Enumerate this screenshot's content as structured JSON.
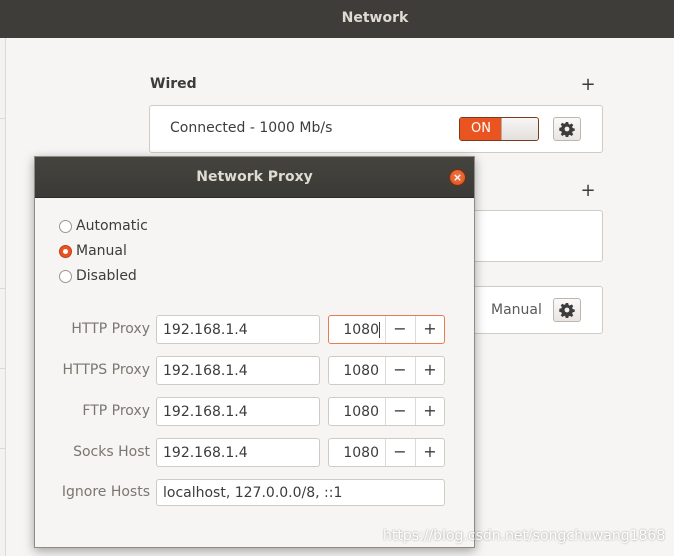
{
  "window": {
    "title": "Network"
  },
  "wired": {
    "section_title": "Wired",
    "add_symbol": "+",
    "status": "Connected - 1000 Mb/s",
    "switch_label": "ON"
  },
  "second_section": {
    "add_symbol": "+"
  },
  "proxy_row": {
    "mode_label": "Manual"
  },
  "dialog": {
    "title": "Network Proxy",
    "close_symbol": "×",
    "modes": [
      {
        "label": "Automatic",
        "checked": false
      },
      {
        "label": "Manual",
        "checked": true
      },
      {
        "label": "Disabled",
        "checked": false
      }
    ],
    "http": {
      "label": "HTTP Proxy",
      "host": "192.168.1.4",
      "port": "1080"
    },
    "https": {
      "label": "HTTPS Proxy",
      "host": "192.168.1.4",
      "port": "1080"
    },
    "ftp": {
      "label": "FTP Proxy",
      "host": "192.168.1.4",
      "port": "1080"
    },
    "socks": {
      "label": "Socks Host",
      "host": "192.168.1.4",
      "port": "1080"
    },
    "ignore": {
      "label": "Ignore Hosts",
      "value": "localhost, 127.0.0.0/8, ::1"
    },
    "spin_minus": "−",
    "spin_plus": "+"
  },
  "watermark": "https://blog.csdn.net/songchuwang1868",
  "colors": {
    "accent": "#e95420",
    "titlebar": "#3e3d39"
  }
}
